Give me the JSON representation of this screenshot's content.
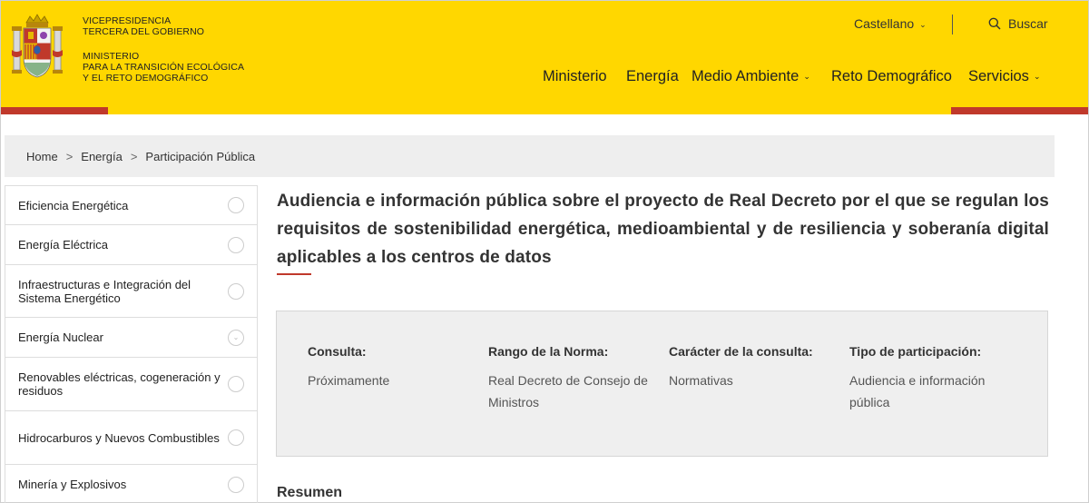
{
  "header": {
    "gov_line1": "VICEPRESIDENCIA",
    "gov_line2": "TERCERA DEL GOBIERNO",
    "ministry_line1": "MINISTERIO",
    "ministry_line2": "PARA LA TRANSICIÓN ECOLÓGICA",
    "ministry_line3": "Y EL RETO DEMOGRÁFICO",
    "language": "Castellano",
    "search_label": "Buscar",
    "colors": {
      "background": "#ffd700",
      "accent": "#c0392b"
    }
  },
  "nav": {
    "items": [
      {
        "label": "Ministerio",
        "dropdown": false
      },
      {
        "label": "Energía",
        "dropdown": false
      },
      {
        "label": "Medio Ambiente",
        "dropdown": true
      },
      {
        "label": "Reto Demográfico",
        "dropdown": false
      },
      {
        "label": "Servicios",
        "dropdown": true
      }
    ]
  },
  "breadcrumb": {
    "items": [
      "Home",
      "Energía",
      "Participación Pública"
    ],
    "separator": ">"
  },
  "sidebar": {
    "items": [
      {
        "label": "Eficiencia Energética",
        "icon": "circle-icon"
      },
      {
        "label": "Energía Eléctrica",
        "icon": "circle-icon"
      },
      {
        "label": "Infraestructuras e Integración del Sistema Energético",
        "icon": "circle-icon"
      },
      {
        "label": "Energía Nuclear",
        "icon": "chevron-down-circle-icon"
      },
      {
        "label": "Renovables eléctricas, cogeneración y residuos",
        "icon": "circle-icon"
      },
      {
        "label": "Hidrocarburos y Nuevos Combustibles",
        "icon": "circle-icon"
      },
      {
        "label": "Minería y Explosivos",
        "icon": "circle-icon"
      }
    ]
  },
  "main": {
    "title": "Audiencia e información pública sobre el proyecto de Real Decreto por el que se regulan los requisitos de sostenibilidad energética, medioambiental y de resiliencia y soberanía digital aplicables a los centros de datos",
    "info": [
      {
        "label": "Consulta:",
        "value": "Próximamente"
      },
      {
        "label": "Rango de la Norma:",
        "value": "Real Decreto de Consejo de Ministros"
      },
      {
        "label": "Carácter de la consulta:",
        "value": "Normativas"
      },
      {
        "label": "Tipo de participación:",
        "value": "Audiencia e información pública"
      }
    ],
    "summary_heading": "Resumen"
  }
}
